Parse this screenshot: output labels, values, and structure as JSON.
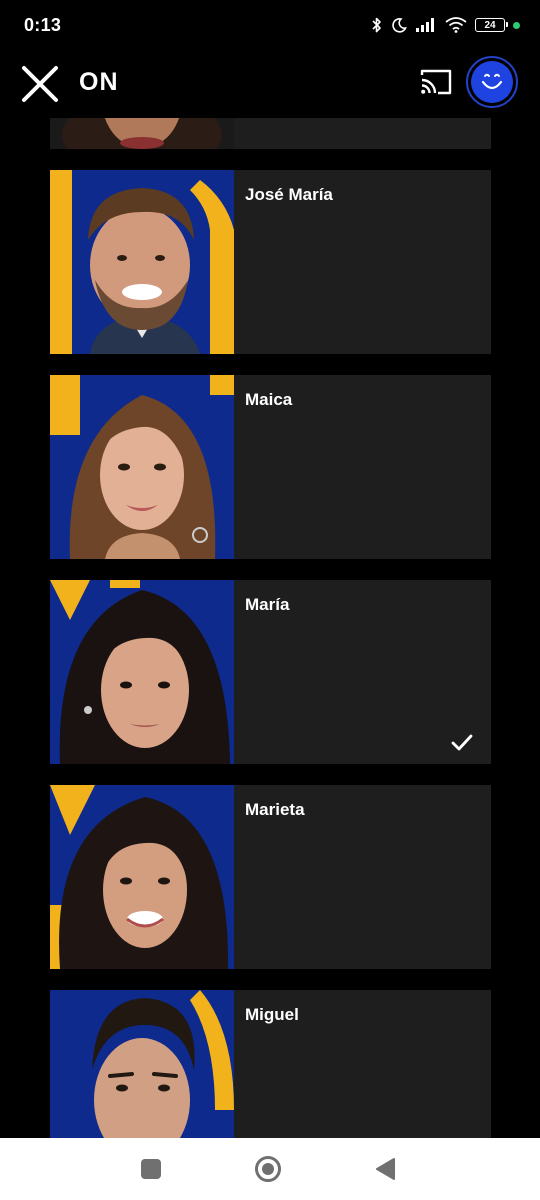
{
  "status_bar": {
    "time": "0:13",
    "battery": "24",
    "icons": [
      "bluetooth-icon",
      "moon-icon",
      "signal-icon",
      "wifi-icon",
      "battery-icon",
      "green-dot-indicator"
    ]
  },
  "header": {
    "brand": "ON",
    "close_icon": "close-icon",
    "cast_icon": "cast-icon",
    "profile_icon": "smiley-avatar-icon"
  },
  "colors": {
    "background": "#000000",
    "card": "#1e1e1e",
    "photo_blue": "#0d2a8c",
    "photo_yellow": "#f2b21b",
    "profile_blue": "#1f43e0"
  },
  "contestants": [
    {
      "name": "",
      "selected": false
    },
    {
      "name": "José María",
      "selected": false
    },
    {
      "name": "Maica",
      "selected": false
    },
    {
      "name": "María",
      "selected": true
    },
    {
      "name": "Marieta",
      "selected": false
    },
    {
      "name": "Miguel",
      "selected": false
    }
  ],
  "nav": {
    "icons": [
      "recents-square-icon",
      "home-circle-icon",
      "back-triangle-icon"
    ]
  }
}
